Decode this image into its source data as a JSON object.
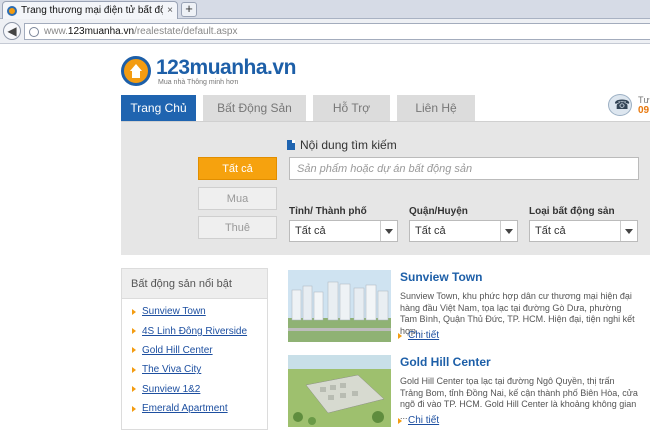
{
  "browser": {
    "tab_title": "Trang thương mại điện tử bất động sản đầu ...",
    "tab_close": "×",
    "new_tab": "+",
    "back": "◀",
    "url_prefix": "www.",
    "url_domain": "123muanha.vn",
    "url_path": "/realestate/default.aspx"
  },
  "site": {
    "logo_name": "123muanha.vn",
    "logo_slogan": "Mua nhà Thông minh hơn",
    "hotline_label": "Tư",
    "hotline_number": "09"
  },
  "nav": {
    "tabs": [
      {
        "label": "Trang Chủ",
        "active": true
      },
      {
        "label": "Bất Động Sản",
        "active": false
      },
      {
        "label": "Hỗ Trợ",
        "active": false
      },
      {
        "label": "Liên Hệ",
        "active": false
      }
    ]
  },
  "search": {
    "types": [
      {
        "label": "Tất cả",
        "active": true
      },
      {
        "label": "Mua",
        "active": false
      },
      {
        "label": "Thuê",
        "active": false
      }
    ],
    "keyword_label": "Nội dung tìm kiếm",
    "keyword_placeholder": "Sản phẩm hoặc dự án bất động sản",
    "province_label": "Tỉnh/ Thành phố",
    "province_value": "Tất cả",
    "district_label": "Quận/Huyện",
    "district_value": "Tất cả",
    "type_label": "Loại bất động sản",
    "type_value": "Tất cả"
  },
  "featured": {
    "heading": "Bất động sản nổi bật",
    "items": [
      "Sunview Town",
      "4S Linh Đông Riverside",
      "Gold Hill Center",
      "The Viva City",
      "Sunview 1&2",
      "Emerald Apartment"
    ]
  },
  "listings": [
    {
      "title": "Sunview Town",
      "description": "Sunview Town, khu phức hợp dân cư thương mại hiện đại hàng đầu Việt Nam, tọa lạc tại đường Gò Dưa, phường Tam Bình, Quận Thủ Đức, TP. HCM. Hiện đại, tiện nghi kết hợp ...",
      "more": "Chi tiết"
    },
    {
      "title": "Gold Hill Center",
      "description": "Gold Hill Center tọa lạc tại đường Ngô Quyền, thị trấn Trảng Bom, tỉnh Đồng Nai, kế cận thành phố Biên Hòa, cửa ngõ đi vào TP. HCM. Gold Hill Center là khoảng không gian ...",
      "more": "Chi tiết"
    }
  ],
  "colors": {
    "brand_blue": "#1f64b0",
    "accent_orange": "#f6a20e",
    "link_blue": "#1d4fa0"
  }
}
